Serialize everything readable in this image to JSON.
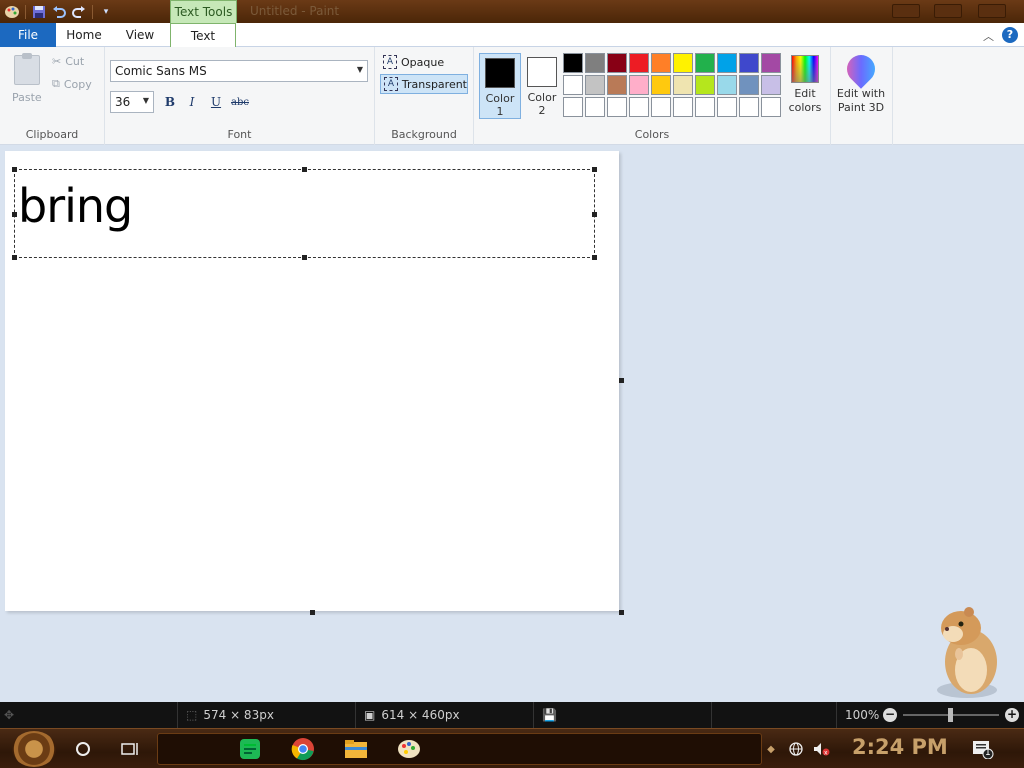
{
  "window": {
    "title": "Untitled - Paint",
    "context_tab_title": "Text Tools"
  },
  "quick_access": {
    "icons": [
      "paint-app-icon",
      "save-icon",
      "undo-icon",
      "redo-icon",
      "customize-qat-icon"
    ]
  },
  "ribbon_tabs": {
    "file": "File",
    "home": "Home",
    "view": "View",
    "text": "Text",
    "active": "Text",
    "help_label": "?"
  },
  "clipboard": {
    "paste_label": "Paste",
    "cut_label": "Cut",
    "copy_label": "Copy",
    "group_label": "Clipboard"
  },
  "font": {
    "family": "Comic Sans MS",
    "size": "36",
    "bold_label": "B",
    "italic_label": "I",
    "underline_label": "U",
    "strikethrough_label": "abc",
    "group_label": "Font"
  },
  "background": {
    "opaque_label": "Opaque",
    "transparent_label": "Transparent",
    "selected": "Transparent",
    "group_label": "Background"
  },
  "colors": {
    "color1_label": "Color",
    "color1_num": "1",
    "color1_value": "#000000",
    "color2_label": "Color",
    "color2_num": "2",
    "color2_value": "#ffffff",
    "edit_colors_line1": "Edit",
    "edit_colors_line2": "colors",
    "paint3d_line1": "Edit with",
    "paint3d_line2": "Paint 3D",
    "group_label": "Colors",
    "palette": [
      "#000000",
      "#7f7f7f",
      "#880015",
      "#ed1c24",
      "#ff7f27",
      "#fff200",
      "#22b14c",
      "#00a2e8",
      "#3f48cc",
      "#a349a4",
      "#ffffff",
      "#c3c3c3",
      "#b97a57",
      "#ffaec9",
      "#ffc90e",
      "#efe4b0",
      "#b5e61d",
      "#99d9ea",
      "#7092be",
      "#c8bfe7",
      "#ffffff",
      "#ffffff",
      "#ffffff",
      "#ffffff",
      "#ffffff",
      "#ffffff",
      "#ffffff",
      "#ffffff",
      "#ffffff",
      "#ffffff"
    ]
  },
  "canvas": {
    "text_content": "bring"
  },
  "statusbar": {
    "selection_size": "574 × 83px",
    "canvas_size": "614 × 460px",
    "zoom": "100%"
  },
  "taskbar": {
    "time": "2:24 PM",
    "pinned": [
      "start-button",
      "cortana-icon",
      "task-view-icon",
      "notes-app-icon",
      "chrome-icon",
      "file-explorer-icon",
      "paint-icon"
    ],
    "notification_count": "1"
  }
}
